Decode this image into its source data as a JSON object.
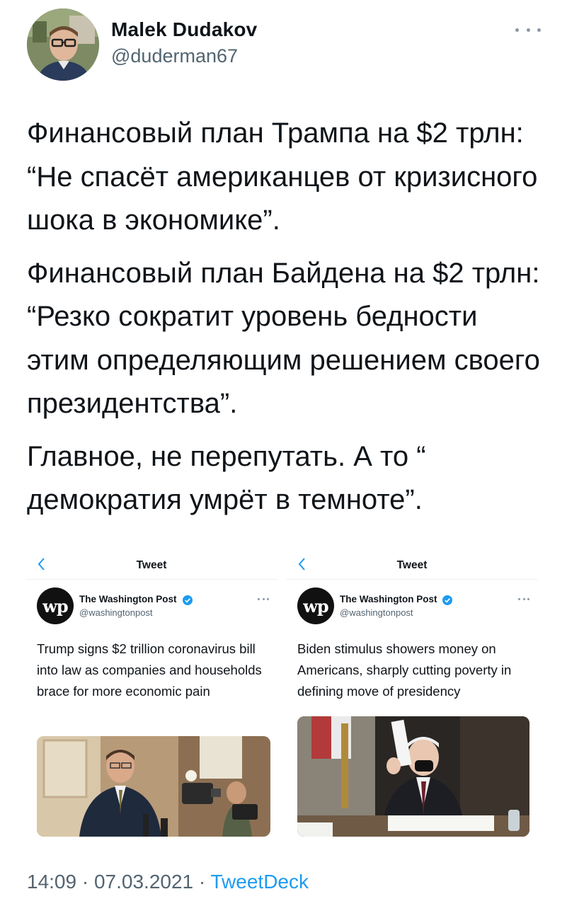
{
  "author": {
    "name": "Malek Dudakov",
    "handle": "@duderman67"
  },
  "tweet": {
    "paragraphs": [
      "Финансовый план Трампа на $2 трлн: “Не спасёт американцев от кризисного шока в экономике”.",
      "Финансовый план Байдена на $2 трлн: “Резко сократит уровень бедности этим определяющим решением своего президентства”.",
      "Главное, не перепутать. А то “ демократия умрёт в темноте”."
    ]
  },
  "embeds": [
    {
      "header_title": "Tweet",
      "account_name": "The Washington Post",
      "account_handle": "@washingtonpost",
      "logo_text": "wp",
      "text": "Trump signs $2 trillion coronavirus bill into law as companies and households brace for more economic pain"
    },
    {
      "header_title": "Tweet",
      "account_name": "The Washington Post",
      "account_handle": "@washingtonpost",
      "logo_text": "wp",
      "text": "Biden stimulus showers money on Americans, sharply cutting poverty in defining move of presidency"
    }
  ],
  "footer": {
    "time": "14:09",
    "separator": " · ",
    "date": "07.03.2021",
    "client": "TweetDeck"
  },
  "colors": {
    "text": "#0f1419",
    "secondary": "#536471",
    "link": "#1d9bf0",
    "verified": "#1d9bf0"
  },
  "icons": {
    "more": "more-horizontal-icon",
    "back": "chevron-left-icon",
    "verified": "verified-badge-icon"
  }
}
